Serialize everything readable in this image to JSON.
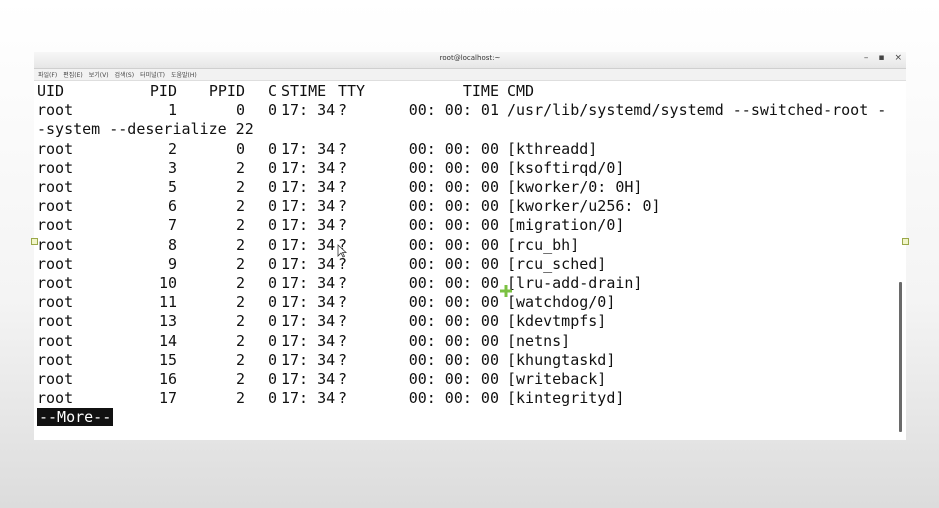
{
  "window": {
    "title": "root@localhost:~",
    "controls": {
      "minimize": "–",
      "maximize": "▪",
      "close": "×"
    }
  },
  "menubar": [
    "파일(F)",
    "편집(E)",
    "보기(V)",
    "검색(S)",
    "터미널(T)",
    "도움말(H)"
  ],
  "terminal": {
    "header": {
      "uid": "UID",
      "pid": "PID",
      "ppid": "PPID",
      "c": "C",
      "stime": "STIME",
      "tty": "TTY",
      "time": "TIME",
      "cmd": "CMD"
    },
    "rows": [
      {
        "uid": "root",
        "pid": "1",
        "ppid": "0",
        "c": "0",
        "stime": "17: 34",
        "tty": "?",
        "time": "00: 00: 01",
        "cmd": "/usr/lib/systemd/systemd --switched-root -"
      },
      {
        "wrap": "-system --deserialize 22"
      },
      {
        "uid": "root",
        "pid": "2",
        "ppid": "0",
        "c": "0",
        "stime": "17: 34",
        "tty": "?",
        "time": "00: 00: 00",
        "cmd": "[kthreadd]"
      },
      {
        "uid": "root",
        "pid": "3",
        "ppid": "2",
        "c": "0",
        "stime": "17: 34",
        "tty": "?",
        "time": "00: 00: 00",
        "cmd": "[ksoftirqd/0]"
      },
      {
        "uid": "root",
        "pid": "5",
        "ppid": "2",
        "c": "0",
        "stime": "17: 34",
        "tty": "?",
        "time": "00: 00: 00",
        "cmd": "[kworker/0: 0H]"
      },
      {
        "uid": "root",
        "pid": "6",
        "ppid": "2",
        "c": "0",
        "stime": "17: 34",
        "tty": "?",
        "time": "00: 00: 00",
        "cmd": "[kworker/u256: 0]"
      },
      {
        "uid": "root",
        "pid": "7",
        "ppid": "2",
        "c": "0",
        "stime": "17: 34",
        "tty": "?",
        "time": "00: 00: 00",
        "cmd": "[migration/0]"
      },
      {
        "uid": "root",
        "pid": "8",
        "ppid": "2",
        "c": "0",
        "stime": "17: 34",
        "tty": "?",
        "time": "00: 00: 00",
        "cmd": "[rcu_bh]"
      },
      {
        "uid": "root",
        "pid": "9",
        "ppid": "2",
        "c": "0",
        "stime": "17: 34",
        "tty": "?",
        "time": "00: 00: 00",
        "cmd": "[rcu_sched]"
      },
      {
        "uid": "root",
        "pid": "10",
        "ppid": "2",
        "c": "0",
        "stime": "17: 34",
        "tty": "?",
        "time": "00: 00: 00",
        "cmd": "[lru-add-drain]"
      },
      {
        "uid": "root",
        "pid": "11",
        "ppid": "2",
        "c": "0",
        "stime": "17: 34",
        "tty": "?",
        "time": "00: 00: 00",
        "cmd": "[watchdog/0]"
      },
      {
        "uid": "root",
        "pid": "13",
        "ppid": "2",
        "c": "0",
        "stime": "17: 34",
        "tty": "?",
        "time": "00: 00: 00",
        "cmd": "[kdevtmpfs]"
      },
      {
        "uid": "root",
        "pid": "14",
        "ppid": "2",
        "c": "0",
        "stime": "17: 34",
        "tty": "?",
        "time": "00: 00: 00",
        "cmd": "[netns]"
      },
      {
        "uid": "root",
        "pid": "15",
        "ppid": "2",
        "c": "0",
        "stime": "17: 34",
        "tty": "?",
        "time": "00: 00: 00",
        "cmd": "[khungtaskd]"
      },
      {
        "uid": "root",
        "pid": "16",
        "ppid": "2",
        "c": "0",
        "stime": "17: 34",
        "tty": "?",
        "time": "00: 00: 00",
        "cmd": "[writeback]"
      },
      {
        "uid": "root",
        "pid": "17",
        "ppid": "2",
        "c": "0",
        "stime": "17: 34",
        "tty": "?",
        "time": "00: 00: 00",
        "cmd": "[kintegrityd]"
      }
    ],
    "pager_prompt": "--More--"
  }
}
